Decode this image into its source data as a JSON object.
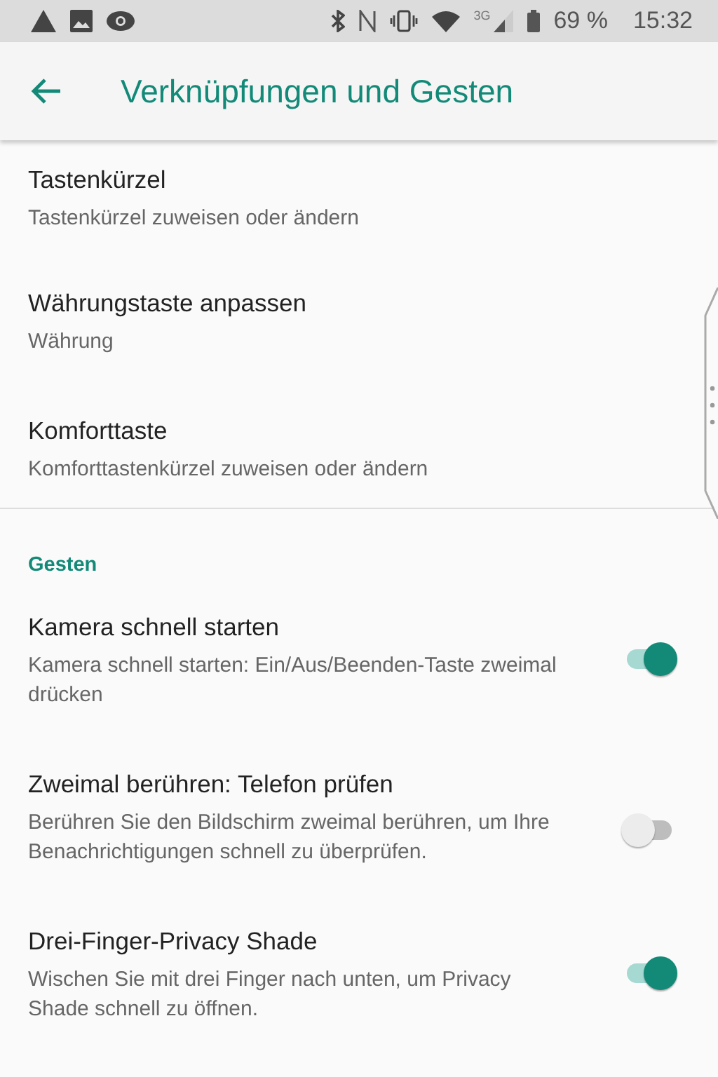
{
  "status_bar": {
    "battery": "69 %",
    "time": "15:32",
    "network": "3G"
  },
  "app_bar": {
    "title": "Verknüpfungen und Gesten"
  },
  "items": [
    {
      "title": "Tastenkürzel",
      "summary": "Tastenkürzel zuweisen oder ändern"
    },
    {
      "title": "Währungstaste anpassen",
      "summary": "Währung"
    },
    {
      "title": "Komforttaste",
      "summary": "Komforttastenkürzel zuweisen oder ändern"
    }
  ],
  "gestures": {
    "header": "Gesten",
    "items": [
      {
        "title": "Kamera schnell starten",
        "summary": "Kamera schnell starten: Ein/Aus/Beenden-Taste zweimal drücken",
        "on": true
      },
      {
        "title": "Zweimal berühren: Telefon prüfen",
        "summary": "Berühren Sie den Bildschirm zweimal berühren, um Ihre Benachrichtigungen schnell zu überprüfen.",
        "on": false
      },
      {
        "title": "Drei-Finger-Privacy Shade",
        "summary": "Wischen Sie mit drei Finger nach unten, um Privacy Shade schnell zu öffnen.",
        "on": true
      }
    ]
  }
}
